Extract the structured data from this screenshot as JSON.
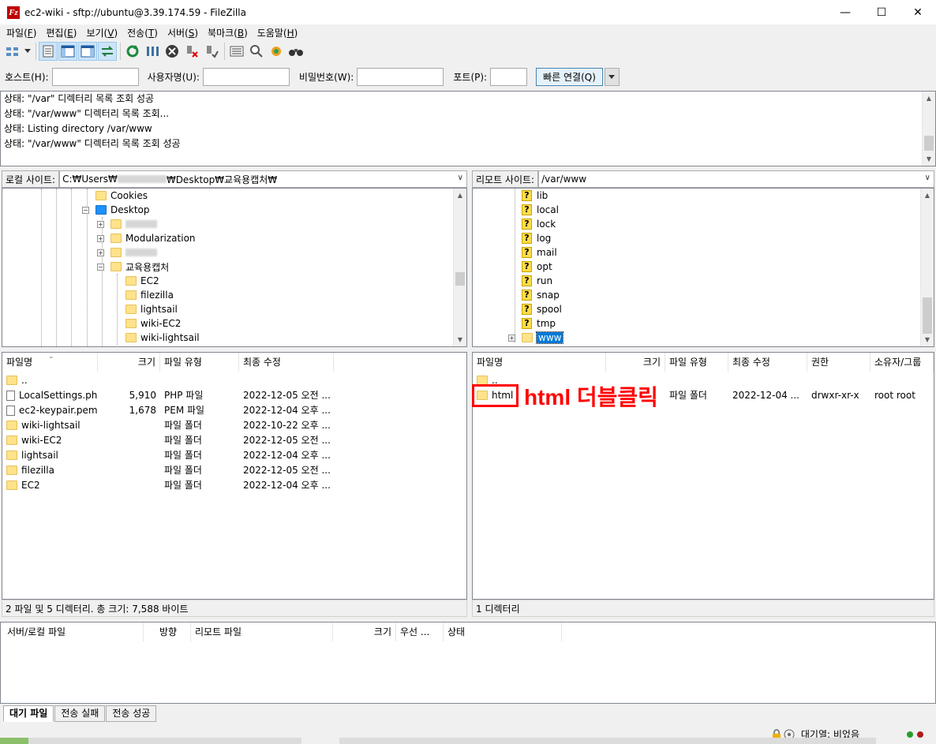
{
  "window": {
    "title": "ec2-wiki - sftp://ubuntu@3.39.174.59 - FileZilla",
    "app_icon": "Fz",
    "controls": [
      "—",
      "☐",
      "✕"
    ]
  },
  "menu": [
    {
      "label": "파일",
      "key": "F"
    },
    {
      "label": "편집",
      "key": "E"
    },
    {
      "label": "보기",
      "key": "V"
    },
    {
      "label": "전송",
      "key": "T"
    },
    {
      "label": "서버",
      "key": "S"
    },
    {
      "label": "북마크",
      "key": "B"
    },
    {
      "label": "도움말",
      "key": "H"
    }
  ],
  "quickconnect": {
    "host_label": "호스트(H):",
    "user_label": "사용자명(U):",
    "pass_label": "비밀번호(W):",
    "port_label": "포트(P):",
    "connect_button": "빠른 연결(Q)",
    "host_value": "",
    "user_value": "",
    "pass_value": "",
    "port_value": ""
  },
  "log": [
    "상태: \"/var\" 디렉터리 목록 조회 성공",
    "상태: \"/var/www\" 디렉터리 목록 조회...",
    "상태: Listing directory /var/www",
    "상태: \"/var/www\" 디렉터리 목록 조회 성공"
  ],
  "local": {
    "site_label": "로컬 사이트:",
    "path_prefix": "C:₩Users₩",
    "path_suffix": "₩Desktop₩교육용캡처₩",
    "tree": [
      {
        "label": "Cookies",
        "depth": 0,
        "icon": "folder"
      },
      {
        "label": "Desktop",
        "depth": 0,
        "icon": "folder-blue",
        "expander": "−"
      },
      {
        "label": "",
        "depth": 1,
        "icon": "folder",
        "expander": "+",
        "blurred": true
      },
      {
        "label": "Modularization",
        "depth": 1,
        "icon": "folder",
        "expander": "+"
      },
      {
        "label": "",
        "depth": 1,
        "icon": "folder",
        "expander": "+",
        "blurred": true
      },
      {
        "label": "교육용캡처",
        "depth": 1,
        "icon": "folder",
        "expander": "−"
      },
      {
        "label": "EC2",
        "depth": 2,
        "icon": "folder"
      },
      {
        "label": "filezilla",
        "depth": 2,
        "icon": "folder"
      },
      {
        "label": "lightsail",
        "depth": 2,
        "icon": "folder"
      },
      {
        "label": "wiki-EC2",
        "depth": 2,
        "icon": "folder"
      },
      {
        "label": "wiki-lightsail",
        "depth": 2,
        "icon": "folder"
      }
    ],
    "columns": [
      "파일명",
      "크기",
      "파일 유형",
      "최종 수정"
    ],
    "rows": [
      {
        "name": "..",
        "size": "",
        "type": "",
        "modified": "",
        "icon": "folder"
      },
      {
        "name": "LocalSettings.php",
        "size": "5,910",
        "type": "PHP 파일",
        "modified": "2022-12-05 오전 ...",
        "icon": "file"
      },
      {
        "name": "ec2-keypair.pem",
        "size": "1,678",
        "type": "PEM 파일",
        "modified": "2022-12-04 오후 ...",
        "icon": "file"
      },
      {
        "name": "wiki-lightsail",
        "size": "",
        "type": "파일 폴더",
        "modified": "2022-10-22 오후 ...",
        "icon": "folder"
      },
      {
        "name": "wiki-EC2",
        "size": "",
        "type": "파일 폴더",
        "modified": "2022-12-05 오전 ...",
        "icon": "folder"
      },
      {
        "name": "lightsail",
        "size": "",
        "type": "파일 폴더",
        "modified": "2022-12-04 오후 ...",
        "icon": "folder"
      },
      {
        "name": "filezilla",
        "size": "",
        "type": "파일 폴더",
        "modified": "2022-12-05 오전 ...",
        "icon": "folder"
      },
      {
        "name": "EC2",
        "size": "",
        "type": "파일 폴더",
        "modified": "2022-12-04 오후 ...",
        "icon": "folder"
      }
    ],
    "status": "2 파일 및 5 디렉터리. 총 크기: 7,588 바이트"
  },
  "remote": {
    "site_label": "리모트 사이트:",
    "path": "/var/www",
    "tree": [
      {
        "label": "lib",
        "icon": "question"
      },
      {
        "label": "local",
        "icon": "question"
      },
      {
        "label": "lock",
        "icon": "question"
      },
      {
        "label": "log",
        "icon": "question"
      },
      {
        "label": "mail",
        "icon": "question"
      },
      {
        "label": "opt",
        "icon": "question"
      },
      {
        "label": "run",
        "icon": "question"
      },
      {
        "label": "snap",
        "icon": "question"
      },
      {
        "label": "spool",
        "icon": "question"
      },
      {
        "label": "tmp",
        "icon": "question"
      },
      {
        "label": "www",
        "icon": "folder",
        "expander": "+",
        "selected": true
      }
    ],
    "columns": [
      "파일명",
      "크기",
      "파일 유형",
      "최종 수정",
      "권한",
      "소유자/그룹"
    ],
    "rows": [
      {
        "name": "..",
        "size": "",
        "type": "",
        "modified": "",
        "perm": "",
        "owner": ""
      },
      {
        "name": "html",
        "size": "",
        "type": "파일 폴더",
        "modified": "2022-12-04 ...",
        "perm": "drwxr-xr-x",
        "owner": "root root"
      }
    ],
    "status": "1 디렉터리"
  },
  "queue": {
    "columns": [
      "서버/로컬 파일",
      "방향",
      "리모트 파일",
      "크기",
      "우선 ...",
      "상태"
    ]
  },
  "tabs": [
    "대기 파일",
    "전송 실패",
    "전송 성공"
  ],
  "statusbar": {
    "queue": "대기열: 비었음"
  },
  "annotation": {
    "text": "html 더블클릭",
    "color": "#ff0000"
  },
  "colors": {
    "selection": "#0078d7",
    "accent_red": "#ff0000"
  }
}
